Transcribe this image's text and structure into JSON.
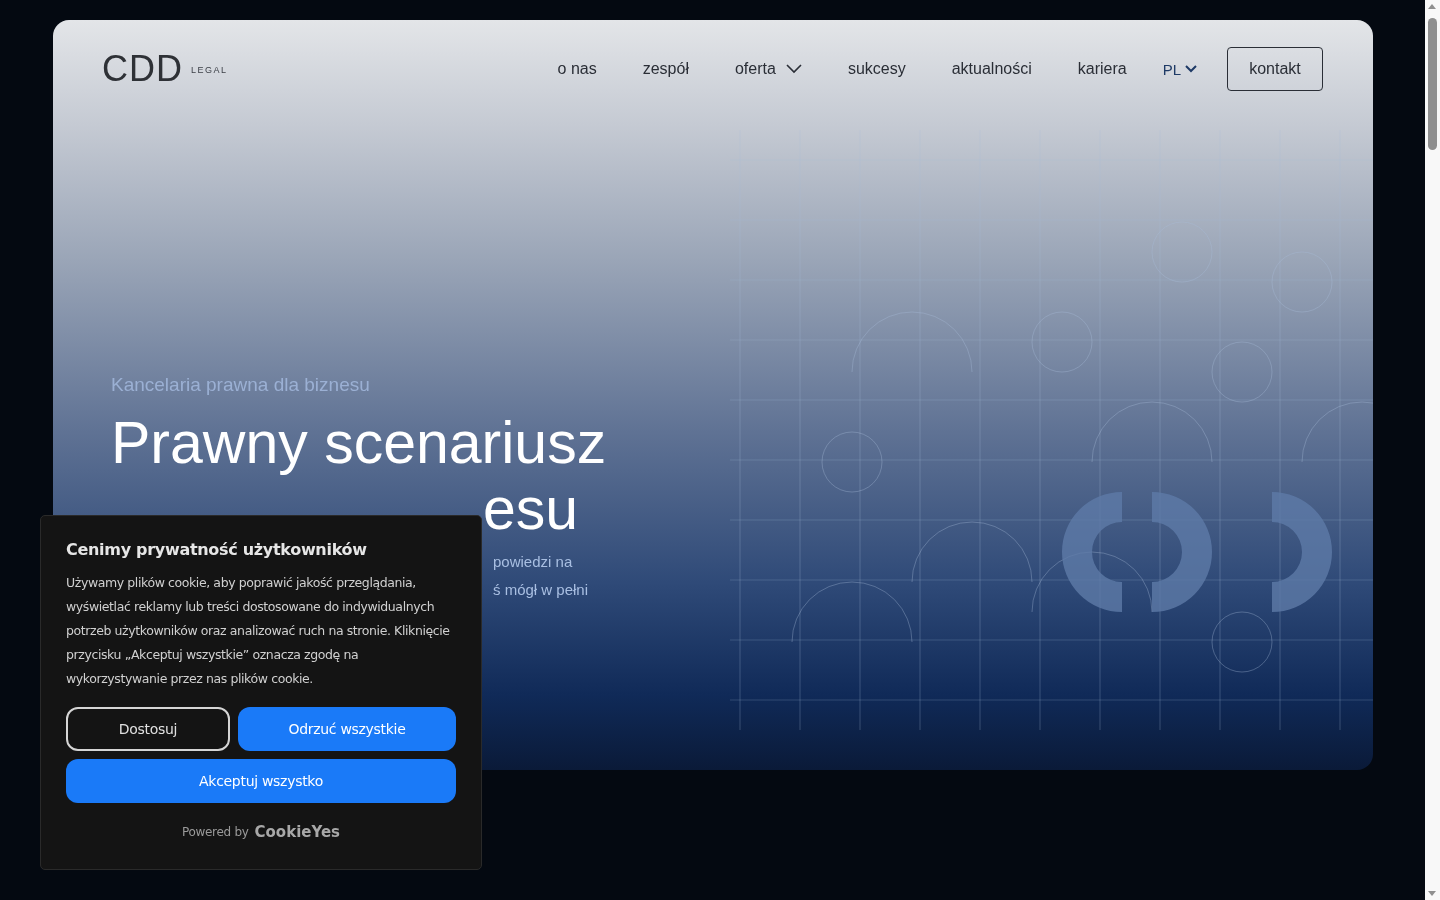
{
  "logo": {
    "mark": "CDD",
    "sub": "LEGAL"
  },
  "nav": [
    {
      "label": "o nas",
      "dropdown": false
    },
    {
      "label": "zespół",
      "dropdown": false
    },
    {
      "label": "oferta",
      "dropdown": true
    },
    {
      "label": "sukcesy",
      "dropdown": false
    },
    {
      "label": "aktualności",
      "dropdown": false
    },
    {
      "label": "kariera",
      "dropdown": false
    }
  ],
  "language": "PL",
  "contact_button": "kontakt",
  "hero": {
    "tagline": "Kancelaria prawna dla biznesu",
    "heading_lines": [
      "Prawny scenariusz",
      "esu"
    ],
    "text_lines": [
      "powiedzi na",
      "ś mógł w pełni"
    ]
  },
  "cookie_banner": {
    "title": "Cenimy prywatność użytkowników",
    "text": "Używamy plików cookie, aby poprawić jakość przeglądania, wyświetlać reklamy lub treści dostosowane do indywidualnych potrzeb użytkowników oraz analizować ruch na stronie. Kliknięcie przycisku „Akceptuj wszystkie” oznacza zgodę na wykorzystywanie przez nas plików cookie.",
    "buttons": [
      {
        "label": "Dostosuj",
        "kind": "outline"
      },
      {
        "label": "Odrzuć wszystkie",
        "kind": "primary"
      },
      {
        "label": "Akceptuj wszystko",
        "kind": "wide"
      }
    ],
    "powered_by": "Powered by",
    "brand": "CookieYes"
  }
}
